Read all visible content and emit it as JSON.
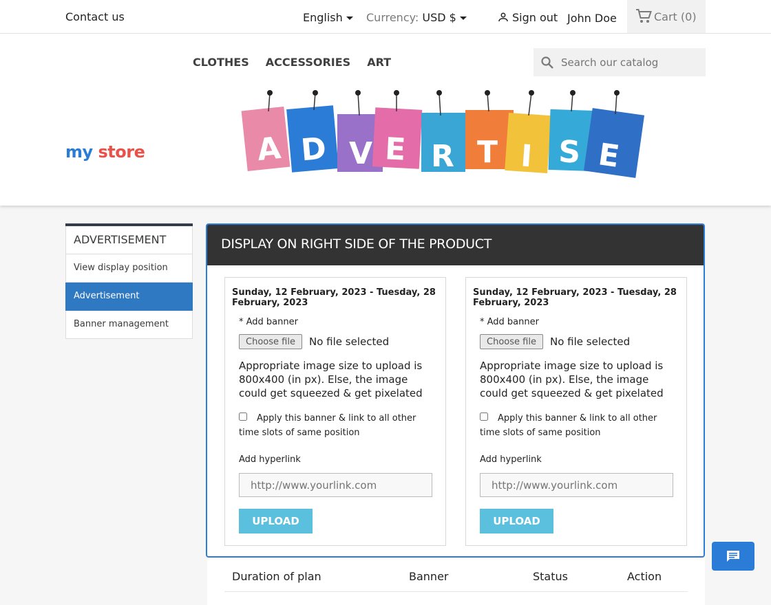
{
  "topbar": {
    "contact": "Contact us",
    "language": "English",
    "currency_label": "Currency:",
    "currency_value": "USD $",
    "signout": "Sign out",
    "username": "John Doe",
    "cart_label": "Cart",
    "cart_count": "(0)"
  },
  "nav": {
    "items": [
      "CLOTHES",
      "ACCESSORIES",
      "ART"
    ]
  },
  "search": {
    "placeholder": "Search our catalog"
  },
  "logo": {
    "part1": "my",
    "part2": "store"
  },
  "banner": {
    "letters": [
      "A",
      "D",
      "V",
      "E",
      "R",
      "T",
      "I",
      "S",
      "E"
    ]
  },
  "sidebar": {
    "title": "ADVERTISEMENT",
    "items": [
      "View display position",
      "Advertisement",
      "Banner management"
    ]
  },
  "table": {
    "headers": [
      "Duration of plan",
      "Banner",
      "Status",
      "Action"
    ]
  },
  "modal": {
    "title": "DISPLAY ON RIGHT SIDE OF THE PRODUCT",
    "cards": [
      {
        "date_range": "Sunday, 12 February, 2023 - Tuesday, 28 February, 2023",
        "add_banner_label": "* Add banner",
        "choose_file": "Choose file",
        "no_file": "No file selected",
        "hint": "Appropriate image size to upload is 800x400 (in px). Else, the image could get squeezed & get pixelated",
        "apply_label": "Apply this banner & link to all other time slots of same position",
        "hyperlink_label": "Add hyperlink",
        "hyperlink_placeholder": "http://www.yourlink.com",
        "upload": "UPLOAD"
      },
      {
        "date_range": "Sunday, 12 February, 2023 - Tuesday, 28 February, 2023",
        "add_banner_label": "* Add banner",
        "choose_file": "Choose file",
        "no_file": "No file selected",
        "hint": "Appropriate image size to upload is 800x400 (in px). Else, the image could get squeezed & get pixelated",
        "apply_label": "Apply this banner & link to all other time slots of same position",
        "hyperlink_label": "Add hyperlink",
        "hyperlink_placeholder": "http://www.yourlink.com",
        "upload": "UPLOAD"
      }
    ]
  },
  "colors": {
    "accent": "#2b7cd6",
    "upload_button": "#5bc0de",
    "sidebar_active": "#2f78c2",
    "modal_header": "#333333"
  },
  "icons": {
    "user": "user-icon",
    "cart": "shopping-cart-icon",
    "search": "search-icon",
    "chat": "chat-icon",
    "caret": "caret-down-icon"
  }
}
